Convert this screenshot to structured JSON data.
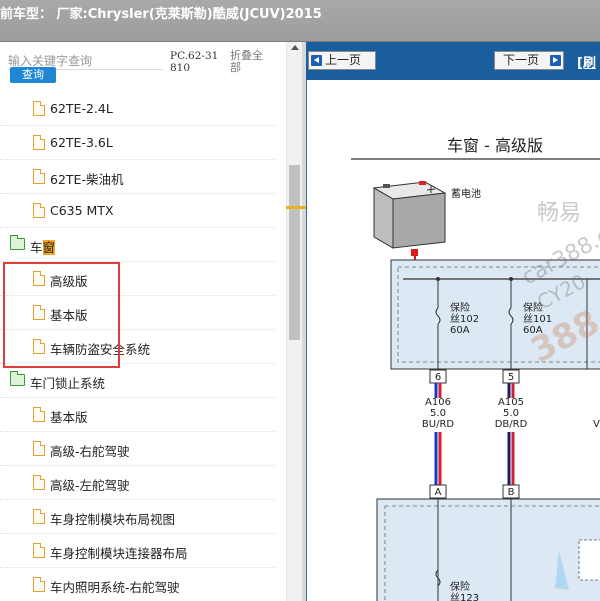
{
  "window": {
    "title": "前车型：  厂家:Chrysler(克莱斯勒)酷威(JCUV)2015"
  },
  "search": {
    "placeholder": "输入关键字查询",
    "button_label": "查询",
    "code": "PC.62-31810",
    "collapse_label": "折叠全部"
  },
  "tree": [
    {
      "type": "leaf",
      "label": "62TE-2.4L"
    },
    {
      "type": "leaf",
      "label": "62TE-3.6L"
    },
    {
      "type": "leaf",
      "label": "62TE-柴油机"
    },
    {
      "type": "leaf",
      "label": "C635 MTX"
    },
    {
      "type": "folder",
      "label_a": "车",
      "label_b": "窗"
    },
    {
      "type": "leaf",
      "label": "高级版"
    },
    {
      "type": "leaf",
      "label": "基本版"
    },
    {
      "type": "leaf",
      "label": "车辆防盗安全系统"
    },
    {
      "type": "folder",
      "label": "车门锁止系统"
    },
    {
      "type": "leaf",
      "label": "基本版"
    },
    {
      "type": "leaf",
      "label": "高级-右舵驾驶"
    },
    {
      "type": "leaf",
      "label": "高级-左舵驾驶"
    },
    {
      "type": "leaf",
      "label": "车身控制模块布局视图"
    },
    {
      "type": "leaf",
      "label": "车身控制模块连接器布局"
    },
    {
      "type": "leaf",
      "label": "车内照明系统-右舵驾驶"
    }
  ],
  "viewer": {
    "prev_label": "上一页",
    "next_label": "下一页",
    "refresh_label": "[刷",
    "diagram": {
      "title": "车窗 - 高级版",
      "battery_label": "蓄电池",
      "fuse1": {
        "word": "保险",
        "id": "丝102",
        "rating": "60A"
      },
      "fuse2": {
        "word": "保险",
        "id": "丝101",
        "rating": "60A"
      },
      "fuse3": {
        "word": "保险",
        "id": "丝123"
      },
      "pins": [
        "6",
        "5"
      ],
      "connectors": [
        "A",
        "B"
      ],
      "wire1": {
        "code": "A106",
        "gauge": "5.0",
        "color": "BU/RD"
      },
      "wire2": {
        "code": "A105",
        "gauge": "5.0",
        "color": "DB/RD"
      },
      "wire3_partial": "V",
      "watermark": [
        "畅易",
        "car388.c",
        "CY20",
        "388"
      ]
    }
  },
  "colors": {
    "titlebar": "#a3a3a3",
    "viewer_frame": "#1a5e9e",
    "highlight_box": "#e23b3b",
    "search_highlight": "#f5a623",
    "module_fill": "#dce9f5"
  }
}
